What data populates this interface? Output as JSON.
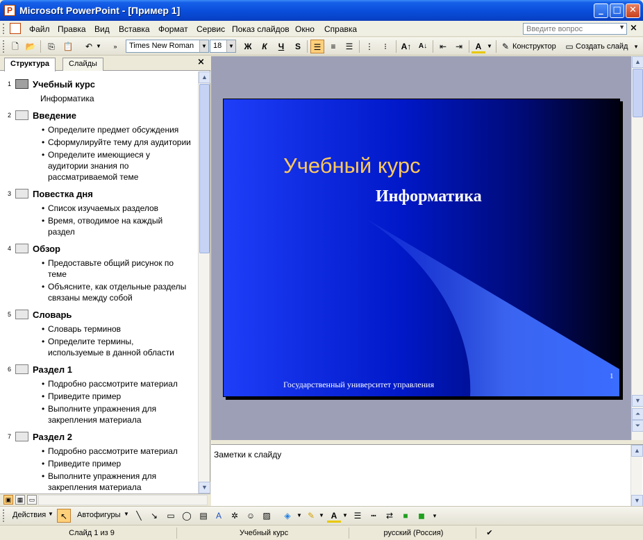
{
  "window": {
    "title": "Microsoft PowerPoint - [Пример 1]"
  },
  "menu": {
    "items": [
      "Файл",
      "Правка",
      "Вид",
      "Вставка",
      "Формат",
      "Сервис",
      "Показ слайдов",
      "Окно",
      "Справка"
    ],
    "question_placeholder": "Введите вопрос"
  },
  "toolbar": {
    "font_name": "Times New Roman",
    "font_size": "18",
    "bold": "Ж",
    "italic": "К",
    "underline": "Ч",
    "shadow": "S",
    "designer_label": "Конструктор",
    "new_slide_label": "Создать слайд"
  },
  "left_pane": {
    "tabs": [
      "Структура",
      "Слайды"
    ],
    "slides": [
      {
        "num": "1",
        "title": "Учебный курс",
        "subtitle": "Информатика",
        "bullets": []
      },
      {
        "num": "2",
        "title": "Введение",
        "subtitle": "",
        "bullets": [
          [
            "Определите предмет обсуждения"
          ],
          [
            "Сформулируйте тему для аудитории"
          ],
          [
            "Определите имеющиеся у",
            "аудитории знания по",
            "рассматриваемой теме"
          ]
        ]
      },
      {
        "num": "3",
        "title": "Повестка дня",
        "subtitle": "",
        "bullets": [
          [
            "Список изучаемых разделов"
          ],
          [
            "Время, отводимое на каждый",
            "раздел"
          ]
        ]
      },
      {
        "num": "4",
        "title": "Обзор",
        "subtitle": "",
        "bullets": [
          [
            "Предоставьте общий рисунок по",
            "теме"
          ],
          [
            "Объясните, как отдельные разделы",
            "связаны между собой"
          ]
        ]
      },
      {
        "num": "5",
        "title": "Словарь",
        "subtitle": "",
        "bullets": [
          [
            "Словарь терминов"
          ],
          [
            "Определите термины,",
            "используемые в данной области"
          ]
        ]
      },
      {
        "num": "6",
        "title": "Раздел 1",
        "subtitle": "",
        "bullets": [
          [
            "Подробно рассмотрите материал"
          ],
          [
            "Приведите пример"
          ],
          [
            "Выполните упражнения для",
            "закрепления материала"
          ]
        ]
      },
      {
        "num": "7",
        "title": "Раздел 2",
        "subtitle": "",
        "bullets": [
          [
            "Подробно рассмотрите материал"
          ],
          [
            "Приведите пример"
          ],
          [
            "Выполните упражнения для",
            "закрепления материала"
          ]
        ]
      }
    ]
  },
  "slide": {
    "title": "Учебный курс",
    "subtitle": "Информатика",
    "footer": "Государственный университет управления",
    "number": "1",
    "colors": {
      "title": "#ffc85c",
      "background_start": "#1e3ef8",
      "background_end": "#000010"
    }
  },
  "notes": {
    "placeholder": "Заметки к слайду"
  },
  "drawbar": {
    "actions_label": "Действия",
    "autoshapes_label": "Автофигуры"
  },
  "status": {
    "slide_of": "Слайд 1 из 9",
    "design": "Учебный курс",
    "language": "русский (Россия)"
  }
}
